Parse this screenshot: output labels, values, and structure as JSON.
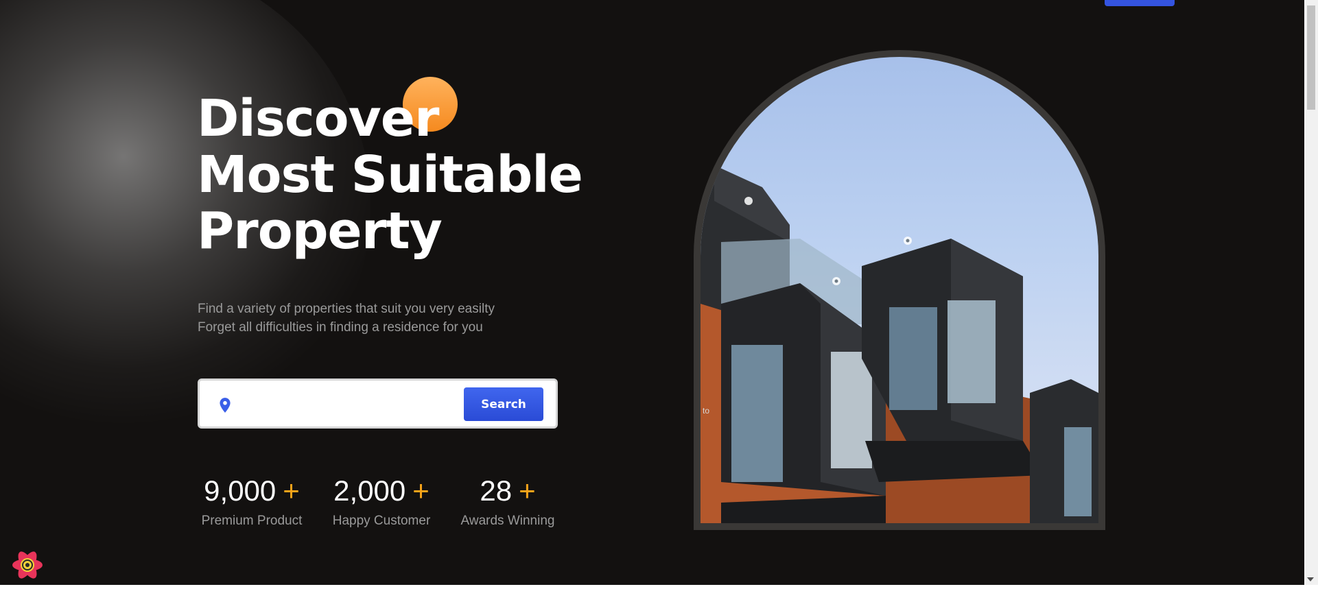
{
  "hero": {
    "title_lines": [
      "Discover",
      "Most Suitable",
      "Property"
    ],
    "subtitle_lines": [
      "Find a variety of properties that suit you very easilty",
      "Forget all difficulties in finding a residence for you"
    ]
  },
  "search": {
    "placeholder": "",
    "value": "",
    "button_label": "Search",
    "icon": "location-pin-icon"
  },
  "stats": [
    {
      "value": "9,000",
      "plus": "+",
      "label": "Premium Product"
    },
    {
      "value": "2,000",
      "plus": "+",
      "label": "Happy Customer"
    },
    {
      "value": "28",
      "plus": "+",
      "label": "Awards Winning"
    }
  ],
  "image": {
    "caption": "to",
    "alt": "modern apartment building"
  },
  "colors": {
    "background": "#131110",
    "accent_orange": "#f5a31a",
    "accent_blue": "#3454e0",
    "text_muted": "#9a9a9a"
  }
}
